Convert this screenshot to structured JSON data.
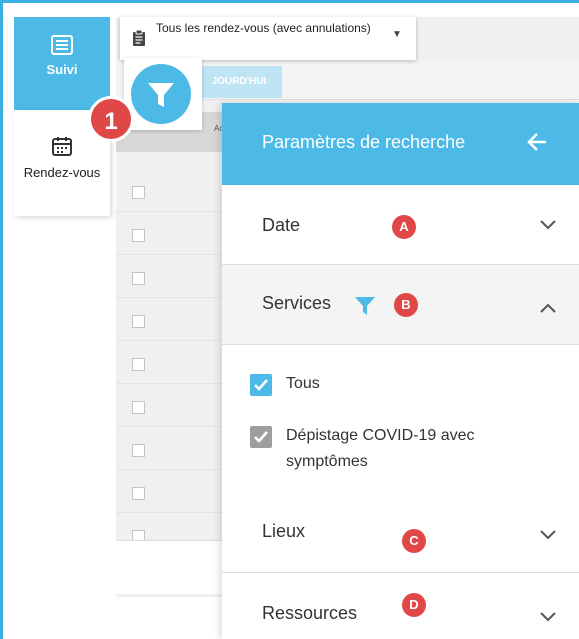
{
  "sidebar": {
    "items": [
      {
        "label": "Suivi",
        "icon": "list-icon"
      },
      {
        "label": "Rendez-vous",
        "icon": "calendar-icon"
      }
    ]
  },
  "toolbar": {
    "filter_select_value": "Tous les rendez-vous (avec annulations)",
    "today_button_label": "JOURD'HUI"
  },
  "table": {
    "header_fragment": "Ac"
  },
  "markers": {
    "filter_button": "1",
    "date": "A",
    "services": "B",
    "lieux": "C",
    "ressources": "D"
  },
  "panel": {
    "title": "Paramètres de recherche",
    "sections": {
      "date": {
        "label": "Date",
        "expanded": false
      },
      "services": {
        "label": "Services",
        "expanded": true,
        "filtered": true,
        "options": [
          {
            "label": "Tous",
            "checked": true,
            "color": "#4db9e6"
          },
          {
            "label": "Dépistage COVID-19 avec symptômes",
            "checked": true,
            "color": "#9e9e9e"
          }
        ]
      },
      "lieux": {
        "label": "Lieux",
        "expanded": false
      },
      "ressources": {
        "label": "Ressources",
        "expanded": false
      }
    }
  },
  "colors": {
    "accent": "#4db9e6",
    "marker": "#e04848"
  }
}
